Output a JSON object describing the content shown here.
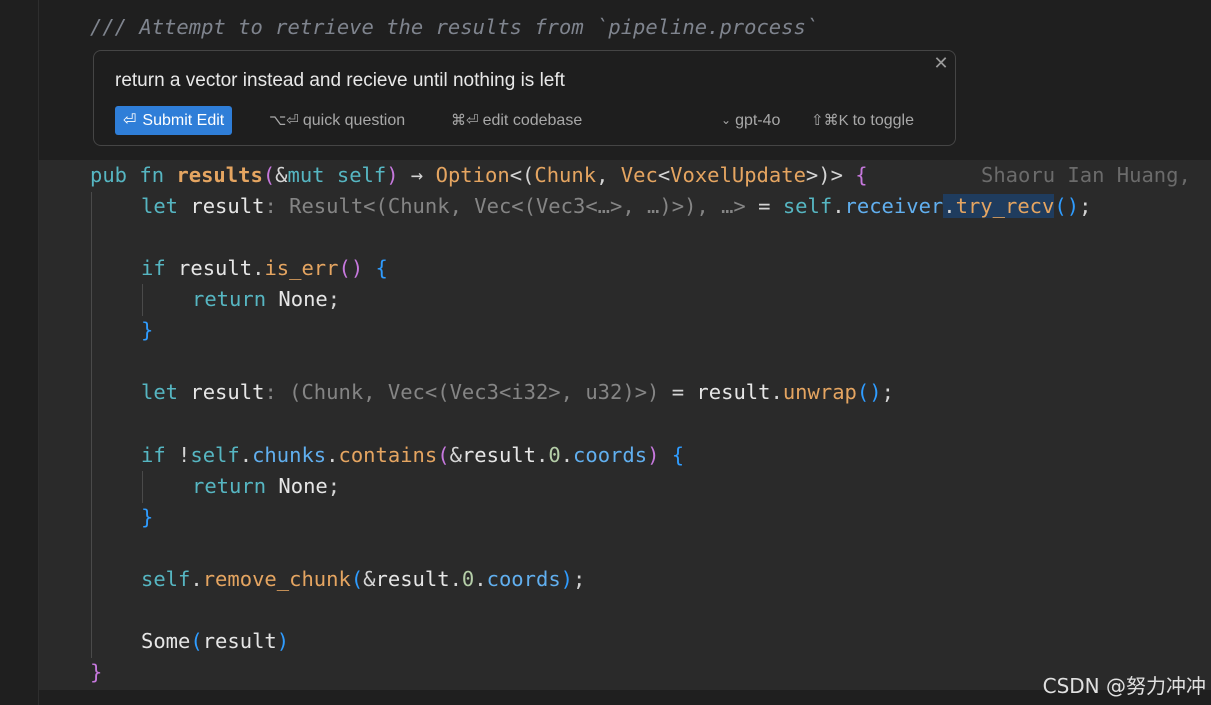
{
  "comment_line": "/// Attempt to retrieve the results from `pipeline.process`",
  "popup": {
    "input_text": "return a vector instead and recieve until nothing is left",
    "submit_label": "Submit Edit",
    "submit_icon": "return-arrow-icon",
    "quick_question_keys": "⌥⏎",
    "quick_question_label": "quick question",
    "edit_codebase_keys": "⌘⏎",
    "edit_codebase_label": "edit codebase",
    "model_label": "gpt-4o",
    "toggle_keys": "⇧⌘K",
    "toggle_label": "to toggle",
    "close_icon": "close-icon"
  },
  "blame": "Shaoru Ian Huang,",
  "code": {
    "l1": {
      "kw1": "pub",
      "kw2": "fn",
      "name": "results",
      "p1": "(",
      "amp": "&",
      "mut": "mut",
      "self": "self",
      "p2": ")",
      "arrow": " → ",
      "opt": "Option",
      "lt": "<(",
      "chunk": "Chunk",
      ",": ", ",
      "vec": "Vec",
      "lt2": "<",
      "voxel": "VoxelUpdate",
      "gt": ">)>",
      "brace": "{"
    },
    "l2": {
      "let": "let",
      "var": "result",
      "colon": ":",
      "hint": " Result<(Chunk, Vec<(Vec3<…>, …)>), …>",
      "eq": " = ",
      "self": "self",
      "dot": ".",
      "field": "receiver",
      "dot2": ".",
      "method": "try_recv",
      "paren": "()",
      "semi": ";"
    },
    "l3": {
      "if": "if",
      "var": "result",
      "dot": ".",
      "method": "is_err",
      "paren": "()",
      "brace": "{"
    },
    "l4": {
      "ret": "return",
      "none": "None",
      "semi": ";"
    },
    "l5": {
      "brace": "}"
    },
    "l6": {
      "let": "let",
      "var": "result",
      "colon": ":",
      "hint": " (Chunk, Vec<(Vec3<i32>, u32)>)",
      "eq": " = ",
      "var2": "result",
      "dot": ".",
      "method": "unwrap",
      "paren": "()",
      "semi": ";"
    },
    "l7": {
      "if": "if",
      "bang": "!",
      "self": "self",
      "dot": ".",
      "field": "chunks",
      "dot2": ".",
      "method": "contains",
      "po": "(",
      "amp": "&",
      "var": "result",
      "dot3": ".",
      "num": "0",
      "dot4": ".",
      "field2": "coords",
      "pc": ")",
      "brace": "{"
    },
    "l8": {
      "ret": "return",
      "none": "None",
      "semi": ";"
    },
    "l9": {
      "brace": "}"
    },
    "l10": {
      "self": "self",
      "dot": ".",
      "method": "remove_chunk",
      "po": "(",
      "amp": "&",
      "var": "result",
      "dot2": ".",
      "num": "0",
      "dot3": ".",
      "field": "coords",
      "pc": ")",
      "semi": ";"
    },
    "l11": {
      "some": "Some",
      "po": "(",
      "var": "result",
      "pc": ")"
    },
    "l12": {
      "brace": "}"
    }
  },
  "watermark": "CSDN @努力冲冲",
  "colors": {
    "background": "#1f1f1f",
    "code_background": "#2a2a2a",
    "keyword": "#56b6c2",
    "function": "#e5a561",
    "field": "#61afef",
    "accent_button": "#2f7ed8",
    "comment": "#7f848e"
  }
}
